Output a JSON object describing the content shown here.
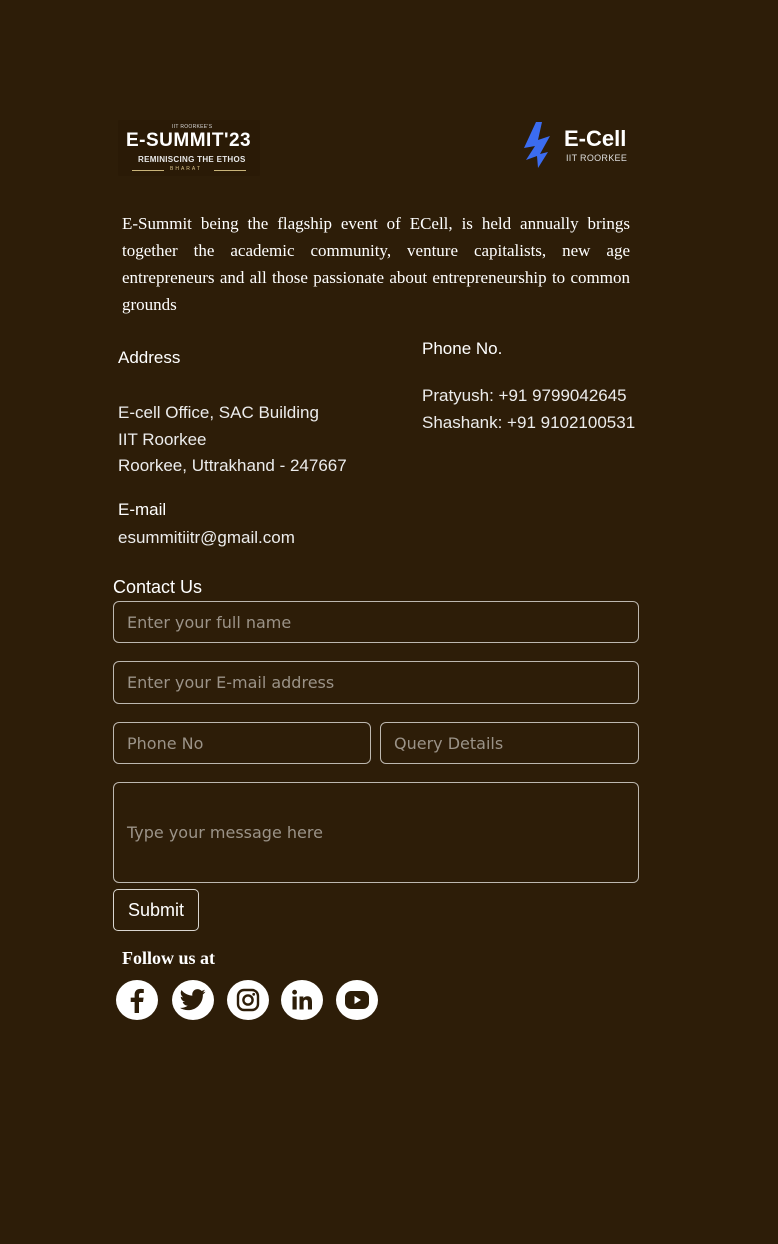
{
  "logos": {
    "esummit": {
      "top_text": "IIT ROORKEE'S",
      "title": "E-SUMMIT",
      "year": "'23",
      "tagline": "REMINISCING THE ETHOS",
      "sub": "BHARAT"
    },
    "ecell": {
      "title": "E-Cell",
      "sub": "IIT ROORKEE",
      "accent_color": "#3b6cf0"
    }
  },
  "description": "E-Summit being the flagship event of ECell, is held annually brings together the academic community, venture capitalists, new age entrepreneurs and all those passionate about entrepreneurship to common grounds",
  "address": {
    "heading": "Address",
    "lines": [
      "E-cell Office, SAC Building",
      "IIT Roorkee",
      "Roorkee, Uttrakhand - 247667"
    ]
  },
  "email": {
    "heading": "E-mail",
    "value": "esummitiitr@gmail.com"
  },
  "phone": {
    "heading": "Phone No.",
    "lines": [
      "Pratyush: +91 9799042645",
      "Shashank: +91 9102100531"
    ]
  },
  "contact_form": {
    "heading": "Contact Us",
    "name_placeholder": "Enter your full name",
    "email_placeholder": "Enter your E-mail address",
    "phone_placeholder": "Phone No",
    "query_placeholder": "Query Details",
    "message_placeholder": "Type your message here",
    "submit_label": "Submit"
  },
  "follow": {
    "heading": "Follow us at",
    "icons": [
      "facebook-icon",
      "twitter-icon",
      "instagram-icon",
      "linkedin-icon",
      "youtube-icon"
    ]
  },
  "colors": {
    "background": "#2d1d08",
    "text": "#ffffff",
    "field_border": "#bdb8b0"
  }
}
